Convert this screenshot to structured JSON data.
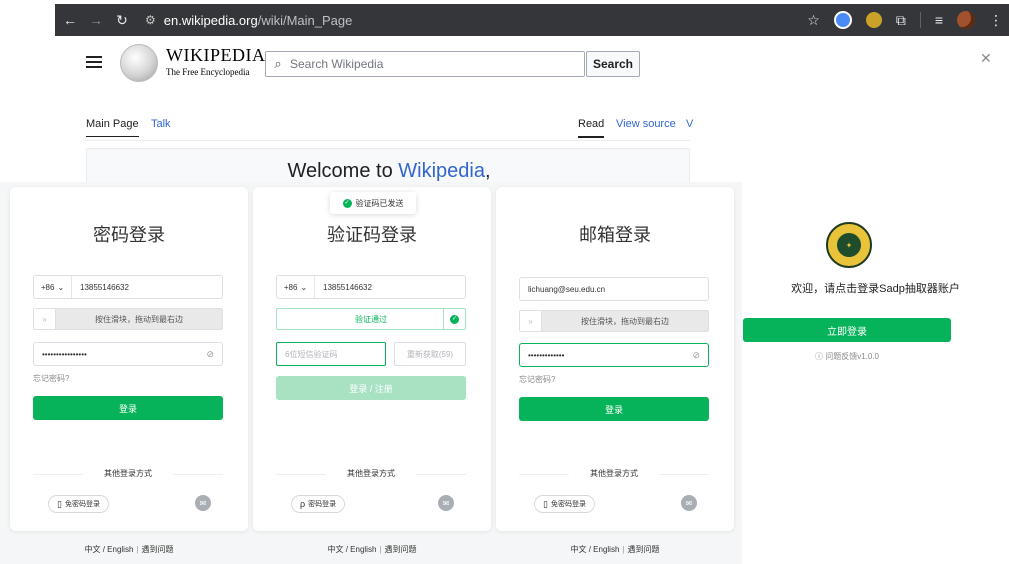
{
  "browser": {
    "url_host": "en.wikipedia.org",
    "url_path": "/wiki/Main_Page"
  },
  "wiki": {
    "wordmark": "WIKIPEDIA",
    "tagline": "The Free Encyclopedia",
    "search_placeholder": "Search Wikipedia",
    "search_button": "Search",
    "tab_main": "Main Page",
    "tab_talk": "Talk",
    "tab_read": "Read",
    "tab_view_source": "View source",
    "tab_truncated": "V",
    "welcome_prefix": "Welcome to ",
    "welcome_link": "Wikipedia",
    "welcome_suffix": ","
  },
  "toast": {
    "text": "验证码已发送"
  },
  "card_password": {
    "title": "密码登录",
    "country_code": "+86",
    "phone": "13855146632",
    "slider_text": "按住滑块，拖动到最右边",
    "password": "••••••••••••••••",
    "forgot": "忘记密码?",
    "login": "登录",
    "other": "其他登录方式",
    "alt_login": "免密码登录"
  },
  "card_code": {
    "title": "验证码登录",
    "country_code": "+86",
    "phone": "13855146632",
    "verified": "验证通过",
    "code_placeholder": "6位短信验证码",
    "resend": "重新获取(59)",
    "login": "登录 / 注册",
    "other": "其他登录方式",
    "alt_login": "密码登录"
  },
  "card_email": {
    "title": "邮箱登录",
    "email": "lichuang@seu.edu.cn",
    "slider_text": "按住滑块，拖动到最右边",
    "password": "•••••••••••••",
    "forgot": "忘记密码?",
    "login": "登录",
    "other": "其他登录方式",
    "alt_login": "免密码登录"
  },
  "footer": {
    "lang": "中文 / English",
    "help": "遇到问题"
  },
  "side": {
    "welcome": "欢迎，请点击登录Sadp抽取器账户",
    "login_now": "立即登录",
    "version": "问题反馈v1.0.0"
  }
}
